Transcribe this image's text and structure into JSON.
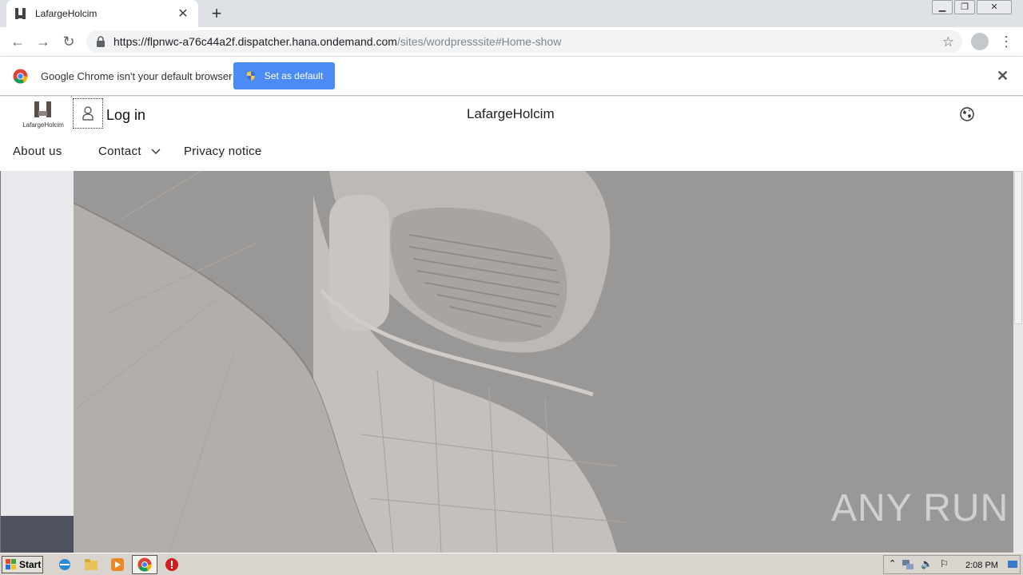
{
  "browser": {
    "tab_title": "LafargeHolcim",
    "url_host": "https://flpnwc-a76c44a2f.dispatcher.hana.ondemand.com",
    "url_path": "/sites/wordpresssite#Home-show"
  },
  "infobar": {
    "message": "Google Chrome isn't your default browser",
    "button_label": "Set as default"
  },
  "site": {
    "logo_text": "LafargeHolcim",
    "login_label": "Log in",
    "title": "LafargeHolcim",
    "nav": {
      "about": "About us",
      "contact": "Contact",
      "privacy": "Privacy notice"
    }
  },
  "watermark": "ANY RUN",
  "taskbar": {
    "start_label": "Start",
    "clock": "2:08 PM"
  }
}
